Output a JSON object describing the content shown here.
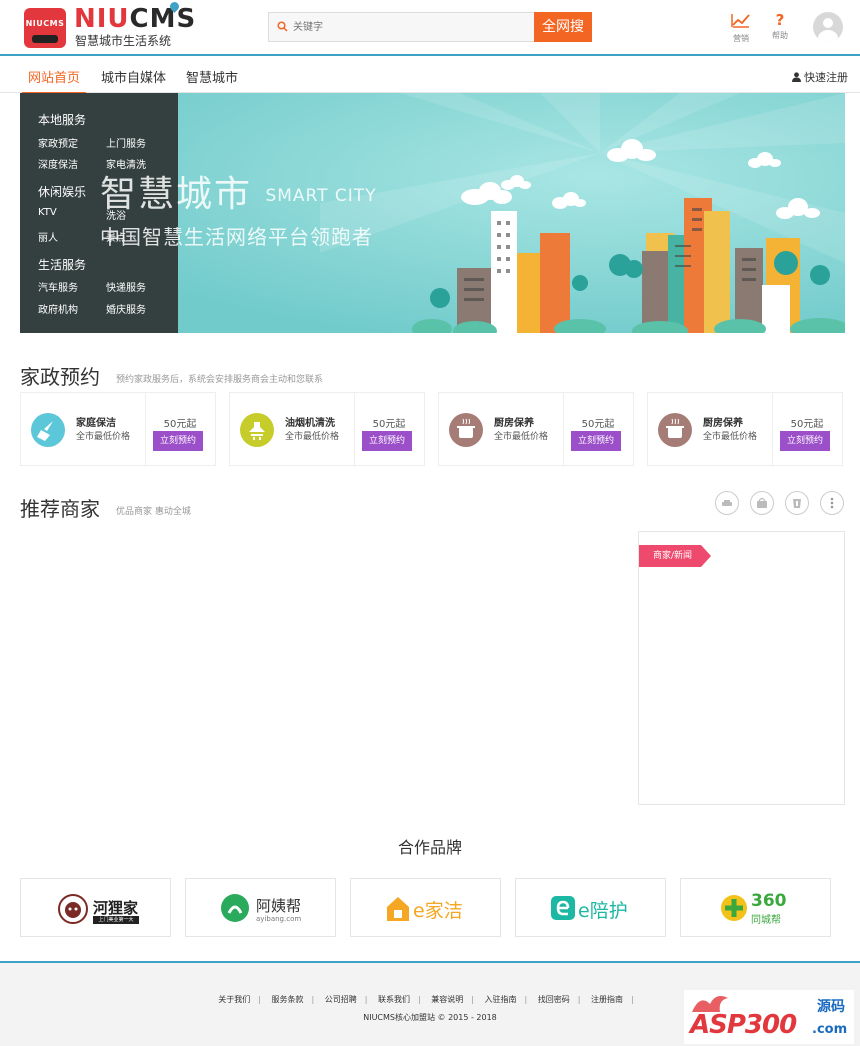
{
  "header": {
    "logo_badge": "NIUCMS",
    "logo_name_a": "NIU",
    "logo_name_b": "CMS",
    "logo_sub": "智慧城市生活系统",
    "search_placeholder": "关键字",
    "search_button": "全网搜",
    "icons": [
      {
        "name": "marketing",
        "label": "营销",
        "icon": "chart-line-icon"
      },
      {
        "name": "help",
        "label": "帮助",
        "icon": "question-icon"
      }
    ],
    "avatar": "user-avatar"
  },
  "nav": {
    "items": [
      {
        "label": "网站首页",
        "active": true
      },
      {
        "label": "城市自媒体",
        "active": false
      },
      {
        "label": "智慧城市",
        "active": false
      }
    ],
    "quick_register": "快速注册"
  },
  "banner": {
    "sidebar": [
      {
        "heading": "本地服务",
        "items": [
          "家政预定",
          "上门服务",
          "深度保洁",
          "家电清洗"
        ]
      },
      {
        "heading": "休闲娱乐",
        "items": [
          "KTV",
          "洗浴",
          "丽人",
          "景点"
        ]
      },
      {
        "heading": "生活服务",
        "items": [
          "汽车服务",
          "快递服务",
          "政府机构",
          "婚庆服务"
        ]
      }
    ],
    "title": "智慧城市",
    "title_en": "SMART CITY",
    "subtitle": "中国智慧生活网络平台领跑者"
  },
  "housekeeping": {
    "title": "家政预约",
    "subtitle": "预约家政服务后，系统会安排服务商会主动和您联系",
    "cards": [
      {
        "name": "家庭保洁",
        "desc": "全市最低价格",
        "price": "50元起",
        "button": "立刻预约",
        "icon": "broom-icon",
        "color": "#5bc7d8"
      },
      {
        "name": "油烟机清洗",
        "desc": "全市最低价格",
        "price": "50元起",
        "button": "立刻预约",
        "icon": "range-hood-icon",
        "color": "#c6cc2a"
      },
      {
        "name": "厨房保养",
        "desc": "全市最低价格",
        "price": "50元起",
        "button": "立刻预约",
        "icon": "pot-icon",
        "color": "#a67c76"
      },
      {
        "name": "厨房保养",
        "desc": "全市最低价格",
        "price": "50元起",
        "button": "立刻预约",
        "icon": "pot-icon",
        "color": "#a67c76"
      }
    ]
  },
  "merchants": {
    "title": "推荐商家",
    "subtitle": "优品商家 惠动全城",
    "filters": [
      "food-icon",
      "shop-icon",
      "drink-icon",
      "more-icon"
    ],
    "news_tag": "商家/新闻"
  },
  "partners": {
    "title": "合作品牌",
    "brands": [
      {
        "name": "河狸家",
        "tagline": "上门美业第一大"
      },
      {
        "name": "阿姨帮",
        "tagline": "ayibang.com"
      },
      {
        "name": "e家洁",
        "tagline": ""
      },
      {
        "name": "e陪护",
        "tagline": ""
      },
      {
        "name": "360",
        "tagline": "同城帮"
      }
    ]
  },
  "footer": {
    "links": [
      "关于我们",
      "服务条款",
      "公司招聘",
      "联系我们",
      "兼容说明",
      "入驻指南",
      "找回密码",
      "注册指南"
    ],
    "copyright": "NIUCMS核心加盟站 © 2015 - 2018"
  },
  "watermark": {
    "text": "ASP300",
    "sub": "源码",
    "suffix": ".com"
  }
}
